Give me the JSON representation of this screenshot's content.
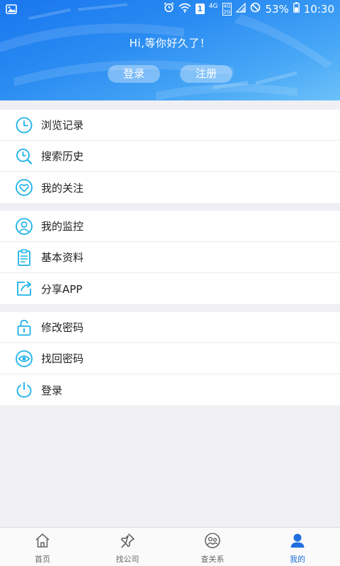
{
  "status_bar": {
    "network": "4G",
    "sim_labels": [
      "4G",
      "2G"
    ],
    "battery": "53%",
    "time": "10:30",
    "sim_slot": "1"
  },
  "header": {
    "greeting": "Hi,等你好久了！",
    "login_label": "登录",
    "register_label": "注册"
  },
  "menu_groups": [
    {
      "items": [
        {
          "icon": "clock-icon",
          "label": "浏览记录"
        },
        {
          "icon": "search-history-icon",
          "label": "搜索历史"
        },
        {
          "icon": "heart-icon",
          "label": "我的关注"
        }
      ]
    },
    {
      "items": [
        {
          "icon": "user-monitor-icon",
          "label": "我的监控"
        },
        {
          "icon": "clipboard-icon",
          "label": "基本资料"
        },
        {
          "icon": "share-icon",
          "label": "分享APP"
        }
      ]
    },
    {
      "items": [
        {
          "icon": "lock-icon",
          "label": "修改密码"
        },
        {
          "icon": "eye-icon",
          "label": "找回密码"
        },
        {
          "icon": "power-icon",
          "label": "登录"
        }
      ]
    }
  ],
  "tab_bar": [
    {
      "icon": "home-icon",
      "label": "首页",
      "active": false
    },
    {
      "icon": "pin-icon",
      "label": "找公司",
      "active": false
    },
    {
      "icon": "relation-icon",
      "label": "查关系",
      "active": false
    },
    {
      "icon": "user-icon",
      "label": "我的",
      "active": true
    }
  ],
  "colors": {
    "accent": "#1ab2e8",
    "tab_active": "#1f6fe0",
    "header_start": "#1976ee",
    "header_end": "#6cc1f8",
    "background": "#efeff4"
  }
}
